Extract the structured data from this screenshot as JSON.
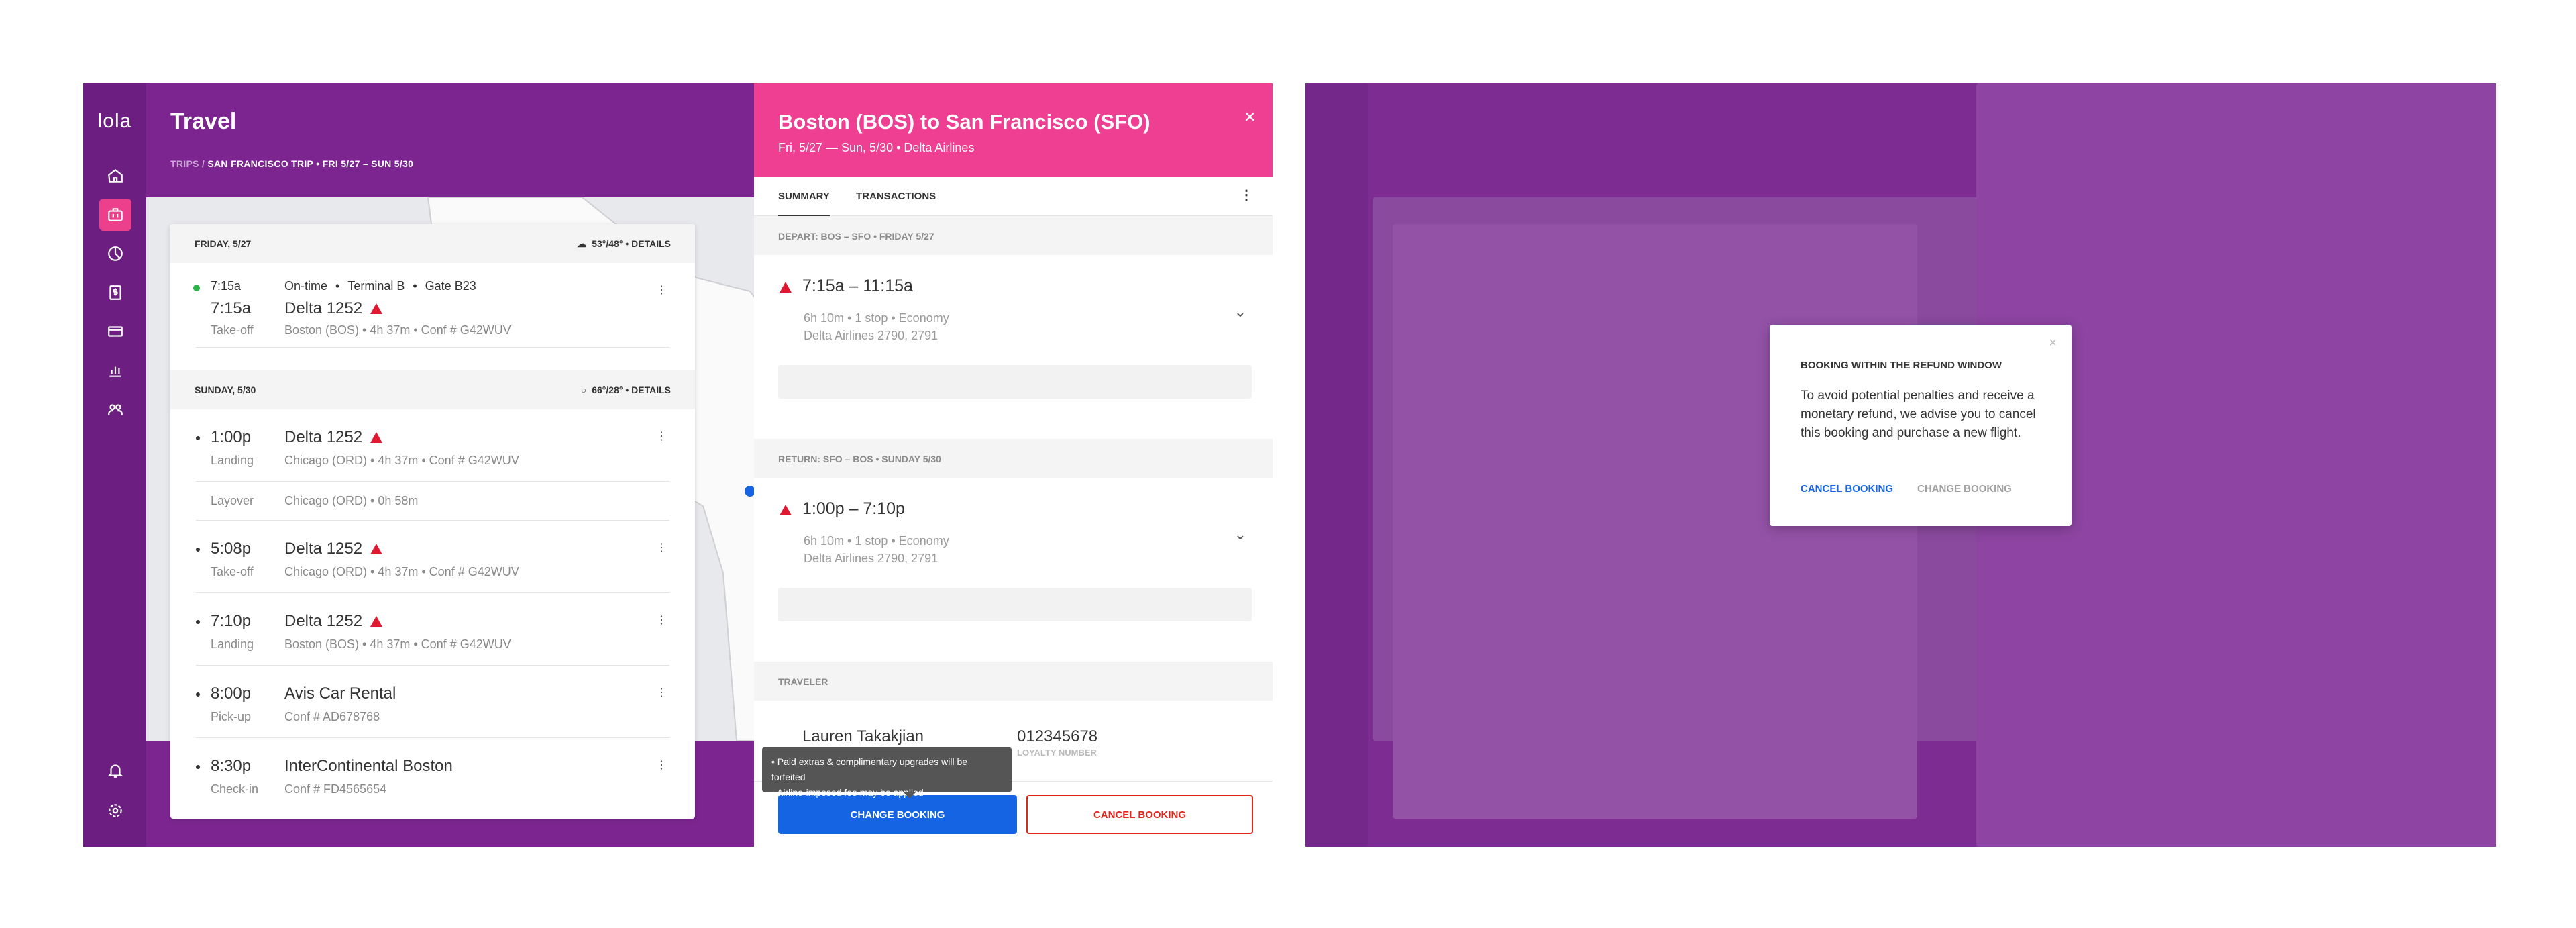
{
  "app": {
    "logo": "lola",
    "title": "Travel"
  },
  "breadcrumb": {
    "root": "TRIPS",
    "sep": "/",
    "trip": "SAN FRANCISCO TRIP",
    "dates": "FRI 5/27 – SUN 5/30"
  },
  "nav_icons": [
    "home-icon",
    "briefcase-icon",
    "pie-chart-icon",
    "dollar-icon",
    "credit-card-icon",
    "bar-chart-icon",
    "team-icon",
    "bell-icon",
    "settings-icon"
  ],
  "days": [
    {
      "label": "FRIDAY, 5/27",
      "weather": "53°/48° • DETAILS",
      "items": [
        {
          "status_time": "7:15a",
          "status": "On-time",
          "terminal": "Terminal B",
          "gate": "Gate B23",
          "time": "7:15a",
          "sub": "Take-off",
          "name": "Delta 1252",
          "detail": "Boston (BOS)  •  4h 37m  •  Conf # G42WUV"
        }
      ]
    },
    {
      "label": "SUNDAY, 5/30",
      "weather": "66°/28° • DETAILS",
      "items": [
        {
          "time": "1:00p",
          "sub": "Landing",
          "name": "Delta 1252",
          "detail": "Chicago (ORD)  •  4h 37m  •  Conf # G42WUV"
        },
        {
          "time": "Layover",
          "detail": "Chicago (ORD) • 0h 58m"
        },
        {
          "time": "5:08p",
          "sub": "Take-off",
          "name": "Delta 1252",
          "detail": "Chicago (ORD)  •  4h 37m  •  Conf # G42WUV"
        },
        {
          "time": "7:10p",
          "sub": "Landing",
          "name": "Delta 1252",
          "detail": "Boston (BOS)  •  4h 37m  •  Conf # G42WUV"
        },
        {
          "time": "8:00p",
          "sub": "Pick-up",
          "name": "Avis Car Rental",
          "detail": "Conf # AD678768"
        },
        {
          "time": "8:30p",
          "sub": "Check-in",
          "name": "InterContinental Boston",
          "detail": "Conf # FD4565654"
        }
      ]
    }
  ],
  "detail": {
    "title": "Boston (BOS) to San Francisco (SFO)",
    "subtitle": "Fri, 5/27 — Sun, 5/30 • Delta Airlines",
    "tabs": [
      "SUMMARY",
      "TRANSACTIONS"
    ],
    "depart": {
      "label": "DEPART: BOS – SFO • FRIDAY 5/27",
      "time": "7:15a – 11:15a",
      "info": "6h 10m • 1 stop • Economy",
      "flights": "Delta Airlines 2790, 2791"
    },
    "return": {
      "label": "RETURN: SFO – BOS • SUNDAY 5/30",
      "time": "1:00p – 7:10p",
      "info": "6h 10m • 1 stop • Economy",
      "flights": "Delta Airlines 2790, 2791"
    },
    "traveler_label": "TRAVELER",
    "traveler_name": "Lauren Takakjian",
    "loyalty_number": "012345678",
    "loyalty_label": "LOYALTY NUMBER",
    "tooltip": [
      "• Paid extras & complimentary upgrades will be forfeited",
      "• Airline-imposed fee may be applied"
    ],
    "change_button": "CHANGE BOOKING",
    "cancel_button": "CANCEL BOOKING"
  },
  "dialog": {
    "title": "BOOKING WITHIN THE REFUND WINDOW",
    "body": "To avoid potential penalties and receive a monetary refund, we advise you to cancel this booking and purchase a new flight.",
    "cancel": "CANCEL BOOKING",
    "change": "CHANGE BOOKING"
  },
  "colors": {
    "purple": "#7c2590",
    "pink": "#ee3f93",
    "blue": "#1464e4",
    "red": "#e0261b",
    "green": "#2bb34a"
  }
}
